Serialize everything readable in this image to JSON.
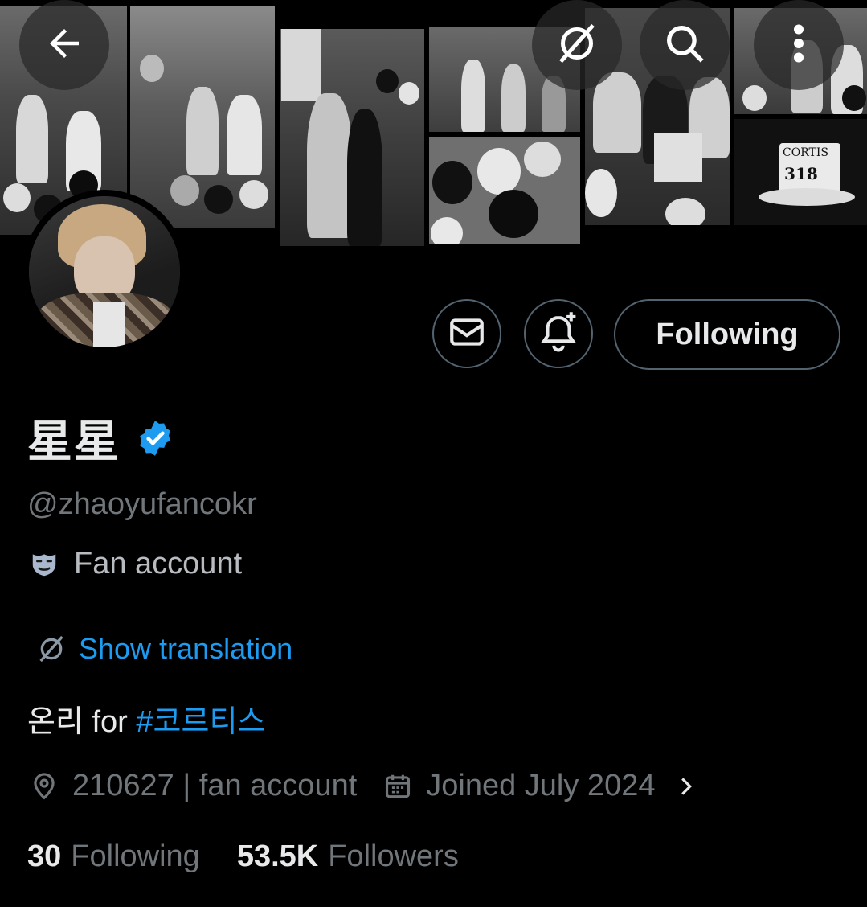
{
  "header": {
    "back_icon": "arrow-left-icon",
    "translate_icon": "translate-icon",
    "search_icon": "search-icon",
    "more_icon": "more-vertical-icon"
  },
  "banner": {
    "cake_text": "CORTIS",
    "cake_number": "318"
  },
  "actions": {
    "message_icon": "mail-icon",
    "notify_icon": "bell-plus-icon",
    "following_label": "Following"
  },
  "profile": {
    "display_name": "星星",
    "verified_icon": "verified-badge-icon",
    "handle": "@zhaoyufancokr",
    "label_icon": "masks-icon",
    "label": "Fan account",
    "show_translation": "Show translation",
    "bio_text": "온리 for ",
    "bio_hashtag": "#코르티스",
    "location": "210627 | fan account",
    "joined": "Joined July 2024"
  },
  "stats": {
    "following_count": "30",
    "following_label": "Following",
    "followers_count": "53.5K",
    "followers_label": "Followers"
  },
  "colors": {
    "background": "#000000",
    "accent": "#1d9bf0",
    "muted_text": "#71767b",
    "border": "#536471"
  }
}
